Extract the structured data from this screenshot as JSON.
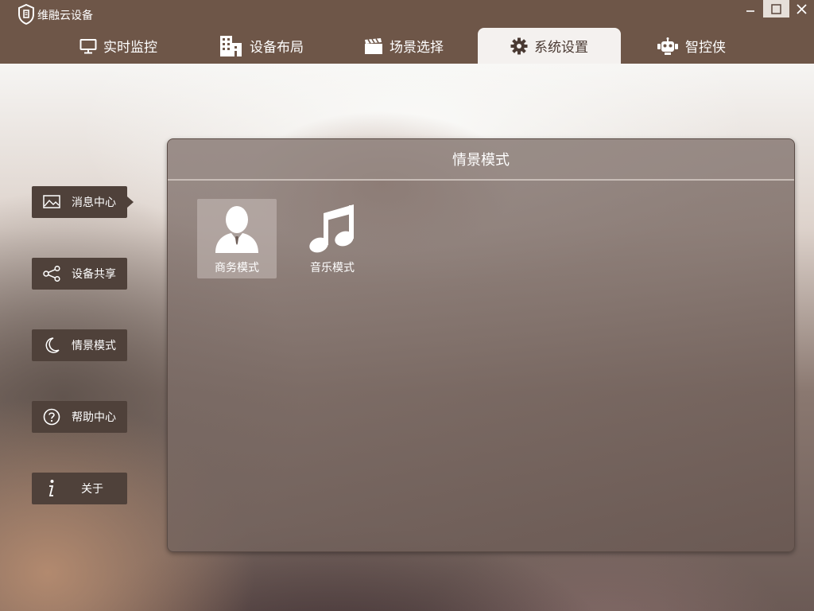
{
  "window": {
    "title": "维融云设备",
    "minimize_icon": "minimize-icon",
    "maximize_icon": "maximize-icon",
    "close_icon": "close-icon"
  },
  "tabs": [
    {
      "label": "实时监控",
      "icon": "monitor-icon",
      "active": false
    },
    {
      "label": "设备布局",
      "icon": "building-icon",
      "active": false
    },
    {
      "label": "场景选择",
      "icon": "clapperboard-icon",
      "active": false
    },
    {
      "label": "系统设置",
      "icon": "gear-icon",
      "active": true
    },
    {
      "label": "智控侠",
      "icon": "robot-icon",
      "active": false
    }
  ],
  "sidebar": {
    "items": [
      {
        "label": "消息中心",
        "icon": "image-icon",
        "selected": true
      },
      {
        "label": "设备共享",
        "icon": "share-icon",
        "selected": false
      },
      {
        "label": "情景模式",
        "icon": "moon-icon",
        "selected": false
      },
      {
        "label": "帮助中心",
        "icon": "question-icon",
        "selected": false
      },
      {
        "label": "关于",
        "icon": "info-icon",
        "selected": false
      }
    ]
  },
  "panel": {
    "title": "情景模式",
    "modes": [
      {
        "label": "商务模式",
        "icon": "businessman-icon",
        "selected": true
      },
      {
        "label": "音乐模式",
        "icon": "music-note-icon",
        "selected": false
      }
    ]
  },
  "colors": {
    "titlebar": "#6e5648",
    "sidebar_button": "#4f413a",
    "active_tab": "#f4f1ef"
  }
}
